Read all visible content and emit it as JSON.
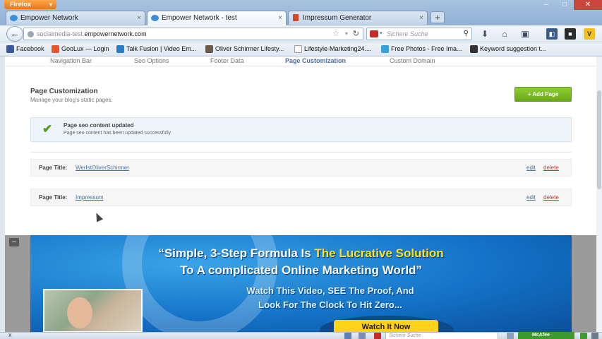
{
  "browser": {
    "app_button": "Firefox",
    "tabs": [
      {
        "label": "Empower Network",
        "active": false
      },
      {
        "label": "Empower Network - test",
        "active": true
      },
      {
        "label": "Impressum Generator",
        "active": false
      }
    ],
    "new_tab": "+",
    "url_prefix": "socialmedia-test.",
    "url_domain": "empowernetwork.com",
    "search_placeholder": "Sichere Suche",
    "bookmarks": [
      {
        "label": "Facebook",
        "color": "#3b5998"
      },
      {
        "label": "GooLux — Login",
        "color": "#e8542a"
      },
      {
        "label": "Talk Fusion | Video Em...",
        "color": "#2a7cc7"
      },
      {
        "label": "Oliver Schirmer Lifesty...",
        "color": "#6b5a4a"
      },
      {
        "label": "Lifestyle-Marketing24....",
        "color": "#ffffff"
      },
      {
        "label": "Free Photos - Free Ima...",
        "color": "#3aa0d8"
      },
      {
        "label": "Keyword suggestion t...",
        "color": "#333333"
      }
    ]
  },
  "subnav": {
    "items": [
      {
        "label": "Navigation Bar",
        "active": false
      },
      {
        "label": "Seo Options",
        "active": false
      },
      {
        "label": "Footer Data",
        "active": false
      },
      {
        "label": "Page Customization",
        "active": true
      },
      {
        "label": "Custom Domain",
        "active": false
      }
    ]
  },
  "main": {
    "title": "Page Customization",
    "subtitle": "Manage your blog's static pages.",
    "add_button": "+ Add Page",
    "alert": {
      "title": "Page seo content updated",
      "message": "Page seo content has been updated successfully"
    },
    "pages": [
      {
        "label": "Page Title:",
        "value": "WerIstOliverSchirmer",
        "edit": "edit",
        "delete": "delete"
      },
      {
        "label": "Page Title:",
        "value": "Impressum",
        "edit": "edit",
        "delete": "delete"
      }
    ]
  },
  "banner": {
    "collapse": "–",
    "line1_a": "“Simple, 3-Step Formula Is ",
    "line1_b": "The Lucrative Solution",
    "line2": "To A complicated Online Marketing World”",
    "line3": "Watch This Video, SEE The Proof, And",
    "line4": "Look For The Clock To Hit Zero...",
    "cta": "Watch It Now"
  },
  "statusbar": {
    "close": "x",
    "search_placeholder": "Sichere Suche",
    "mcafee": "McAfee"
  },
  "colors": {
    "accent_green": "#6aa81a",
    "link_blue": "#4a6fa0",
    "delete_red": "#c0392b",
    "banner_yellow": "#ffe31a"
  }
}
